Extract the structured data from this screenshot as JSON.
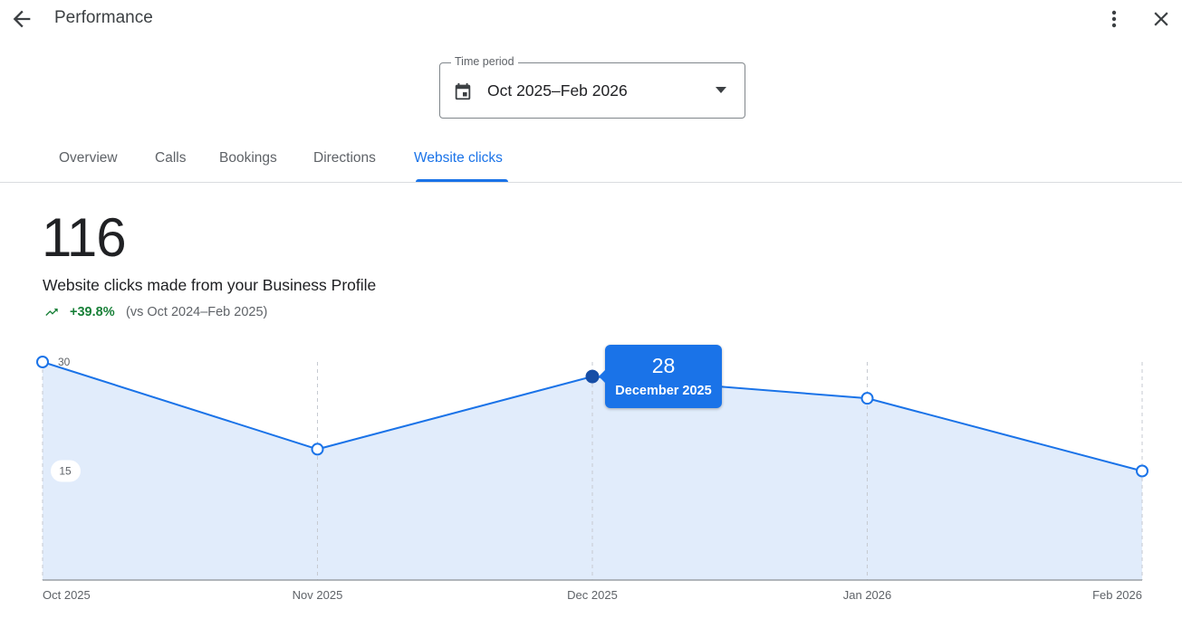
{
  "header": {
    "title": "Performance",
    "back_icon": "arrow-back-icon",
    "more_icon": "more-vert-icon",
    "close_icon": "close-icon"
  },
  "time_period": {
    "label": "Time period",
    "value": "Oct 2025–Feb 2026",
    "icon": "calendar-icon"
  },
  "tabs": [
    {
      "label": "Overview",
      "active": false
    },
    {
      "label": "Calls",
      "active": false
    },
    {
      "label": "Bookings",
      "active": false
    },
    {
      "label": "Directions",
      "active": false
    },
    {
      "label": "Website clicks",
      "active": true
    }
  ],
  "summary": {
    "total": "116",
    "description": "Website clicks made from your Business Profile",
    "change": "+39.8%",
    "comparison": "(vs Oct 2024–Feb 2025)"
  },
  "tooltip": {
    "value": "28",
    "label": "December 2025"
  },
  "colors": {
    "accent": "#1a73e8",
    "area_fill": "#e1ecfb",
    "positive": "#188038"
  },
  "chart_data": {
    "type": "area",
    "categories": [
      "Oct 2025",
      "Nov 2025",
      "Dec 2025",
      "Jan 2026",
      "Feb 2026"
    ],
    "values": [
      30,
      18,
      28,
      25,
      15
    ],
    "y_ticks": [
      "30",
      "15"
    ],
    "ylim": [
      0,
      30
    ],
    "highlighted_index": 2,
    "grid": "vertical-dashed"
  }
}
